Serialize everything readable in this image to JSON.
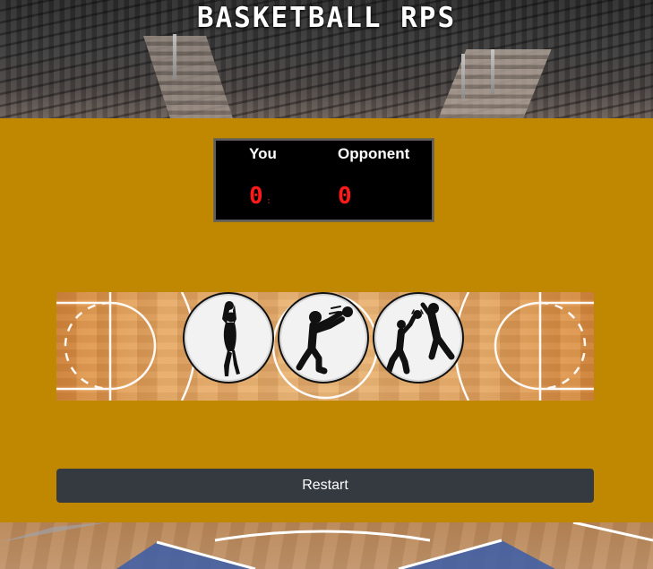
{
  "game": {
    "title": "BASKETBALL RPS"
  },
  "scoreboard": {
    "player_label": "You",
    "opponent_label": "Opponent",
    "player_score": "0",
    "opponent_score": "0"
  },
  "choices": [
    {
      "icon": "jump-shot-icon"
    },
    {
      "icon": "pass-icon"
    },
    {
      "icon": "block-icon"
    }
  ],
  "controls": {
    "restart_label": "Restart"
  },
  "colors": {
    "gold": "#c08700",
    "button": "#343a40",
    "score_red": "#ff1a1a"
  }
}
